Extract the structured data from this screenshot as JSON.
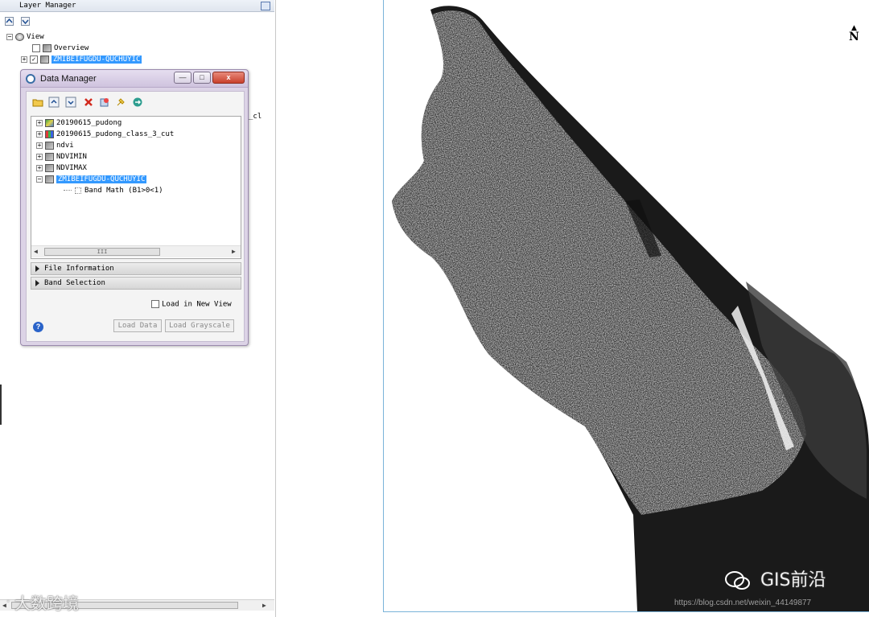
{
  "layer_manager": {
    "title": "Layer Manager",
    "tree": {
      "root": "View",
      "items": [
        {
          "label": "Overview",
          "checked": false
        },
        {
          "label": "ZMIBEIFUGDU-QUCHUYIC",
          "checked": true,
          "selected": true
        }
      ],
      "partial_text": "_cl"
    }
  },
  "data_manager": {
    "title": "Data Manager",
    "window_buttons": {
      "minimize": "—",
      "maximize": "□",
      "close": "x"
    },
    "files": [
      {
        "label": "20190615_pudong",
        "icon": "raster-color-icon"
      },
      {
        "label": "20190615_pudong_class_3_cut",
        "icon": "classification-icon"
      },
      {
        "label": "ndvi",
        "icon": "raster-gray-icon"
      },
      {
        "label": "NDVIMIN",
        "icon": "raster-gray-icon"
      },
      {
        "label": "NDVIMAX",
        "icon": "raster-gray-icon"
      },
      {
        "label": "ZMIBEIFUGDU-QUCHUYIC",
        "icon": "raster-gray-icon",
        "selected": true
      }
    ],
    "child": {
      "label": "Band Math (B1>0<1)"
    },
    "scroll_thumb": "III",
    "sections": {
      "file_info": "File Information",
      "band_selection": "Band Selection"
    },
    "load_in_new_view": "Load in New View",
    "load_in_new_view_checked": false,
    "buttons": {
      "load_data": "Load Data",
      "load_grayscale": "Load Grayscale"
    },
    "help": "?"
  },
  "map": {
    "north_label": "N"
  },
  "watermarks": {
    "left": "大数跨境",
    "right": "GIS前沿",
    "url": "https://blog.csdn.net/weixin_44149877"
  },
  "colors": {
    "selection": "#3399ff",
    "dialog_frame": "#dcd3e6",
    "map_border": "#7ab3d9"
  }
}
